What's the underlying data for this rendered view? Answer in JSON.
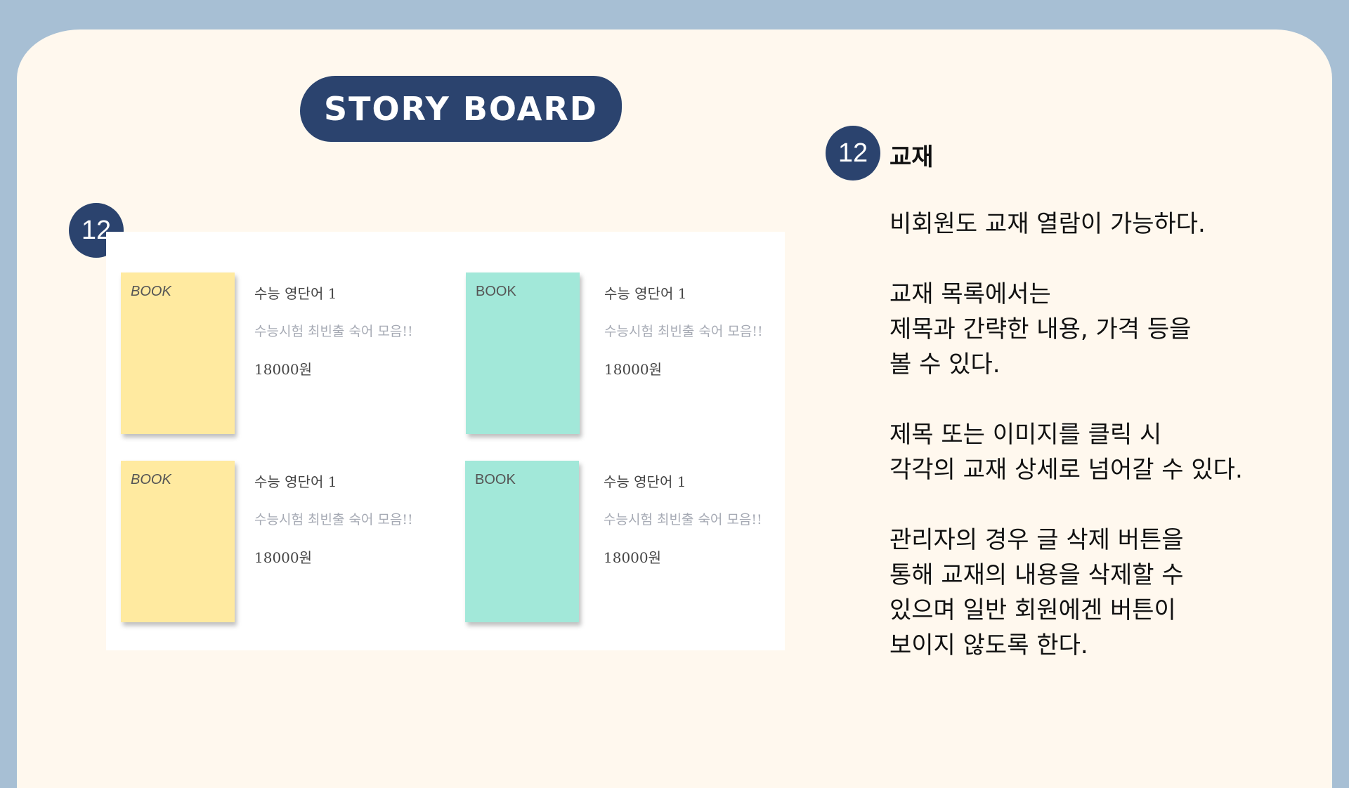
{
  "header": {
    "title": "STORY BOARD"
  },
  "badge_number": "12",
  "section": {
    "number": "12",
    "title": "교재"
  },
  "description": [
    [
      "비회원도 교재 열람이 가능하다."
    ],
    [
      "교재 목록에서는",
      "제목과 간략한 내용, 가격 등을",
      "볼 수 있다."
    ],
    [
      "제목 또는 이미지를 클릭 시",
      "각각의 교재 상세로 넘어갈 수 있다."
    ],
    [
      "관리자의 경우 글 삭제 버튼을",
      "통해 교재의 내용을 삭제할 수",
      "있으며 일반 회원에겐 버튼이",
      "보이지 않도록 한다."
    ]
  ],
  "books": [
    {
      "cover_label": "BOOK",
      "cover_color": "#ffeaa0",
      "title": "수능 영단어 1",
      "subtitle": "수능시험 최빈출 숙어 모음!!",
      "price": "18000원"
    },
    {
      "cover_label": "BOOK",
      "cover_color": "#a2e8d9",
      "title": "수능 영단어 1",
      "subtitle": "수능시험 최빈출 숙어 모음!!",
      "price": "18000원"
    },
    {
      "cover_label": "BOOK",
      "cover_color": "#ffeaa0",
      "title": "수능 영단어 1",
      "subtitle": "수능시험 최빈출 숙어 모음!!",
      "price": "18000원"
    },
    {
      "cover_label": "BOOK",
      "cover_color": "#a2e8d9",
      "title": "수능 영단어 1",
      "subtitle": "수능시험 최빈출 숙어 모음!!",
      "price": "18000원"
    }
  ],
  "colors": {
    "accent": "#2b436e",
    "background": "#a7bfd4",
    "paper": "#fff8ee"
  }
}
